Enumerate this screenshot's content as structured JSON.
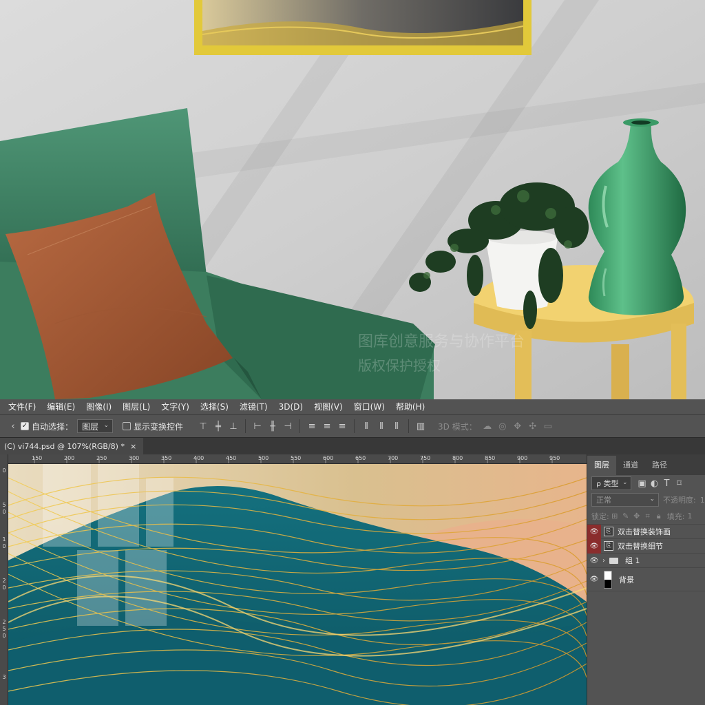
{
  "menu": [
    "文件(F)",
    "编辑(E)",
    "图像(I)",
    "图层(L)",
    "文字(Y)",
    "选择(S)",
    "滤镜(T)",
    "3D(D)",
    "视图(V)",
    "窗口(W)",
    "帮助(H)"
  ],
  "options": {
    "auto_select_label": "自动选择：",
    "auto_select_checked": true,
    "auto_select_value": "图层",
    "show_transform_label": "显示变换控件",
    "mode_3d_label": "3D 模式："
  },
  "document_tab": {
    "title": "(C) vi744.psd @ 107%(RGB/8) *",
    "close": "×"
  },
  "ruler": {
    "horizontal": [
      "150",
      "200",
      "250",
      "300",
      "350",
      "400",
      "450",
      "500",
      "550",
      "600",
      "650",
      "700",
      "750",
      "800",
      "850",
      "900",
      "950"
    ],
    "vertical": [
      "0",
      "5",
      "0",
      "1",
      "0",
      "2",
      "0",
      "2",
      "5",
      "0",
      "3"
    ]
  },
  "watermark": {
    "line1": "图库创意服务与协作平台",
    "line2": "版权保护授权"
  },
  "layers_panel": {
    "tabs": [
      "图层",
      "通道",
      "路径"
    ],
    "active_tab": "图层",
    "filter_label": "ρ 类型",
    "blend_mode": "正常",
    "opacity_label": "不透明度:",
    "opacity_value": "1",
    "lock_label": "锁定:",
    "fill_label": "填充:",
    "fill_value": "1",
    "layers": [
      {
        "name": "双击替换装饰画",
        "highlight": true,
        "type": "smart"
      },
      {
        "name": "双击替换细节",
        "highlight": true,
        "type": "smart"
      },
      {
        "name": "组 1",
        "highlight": false,
        "type": "group"
      },
      {
        "name": "背景",
        "highlight": false,
        "type": "background"
      }
    ]
  }
}
